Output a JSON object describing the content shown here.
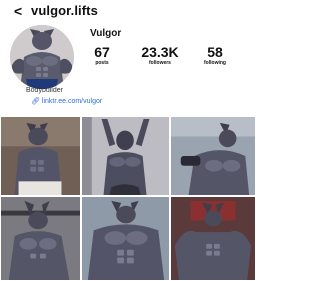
{
  "header": {
    "back_icon": "chevron-left-icon",
    "username": "vulgor.lifts"
  },
  "profile": {
    "display_name": "Vulgor",
    "stats": {
      "posts": {
        "value": "67",
        "label": "posts"
      },
      "followers": {
        "value": "23.3K",
        "label": "followers"
      },
      "following": {
        "value": "58",
        "label": "following"
      }
    },
    "bio": "Bodybuilder",
    "link_icon": "link-icon",
    "link": "linktr.ee.com/vulgor"
  },
  "grid": {
    "tiles": [
      "post-1",
      "post-2",
      "post-3",
      "post-4",
      "post-5",
      "post-6"
    ]
  },
  "colors": {
    "link": "#2d6ed8",
    "text": "#111111",
    "background": "#ffffff"
  }
}
